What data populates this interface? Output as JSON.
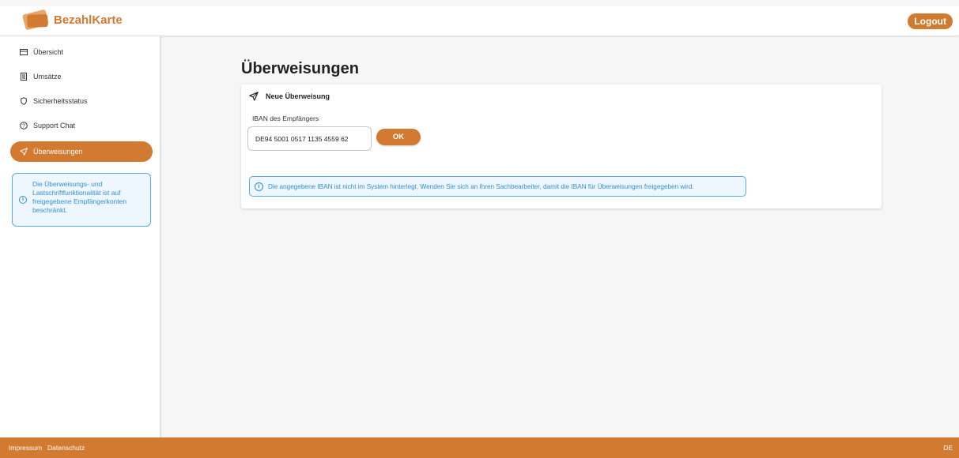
{
  "header": {
    "brand": "BezahlKarte",
    "logout_label": "Logout"
  },
  "sidebar": {
    "items": [
      {
        "label": "Übersicht",
        "icon": "card-icon"
      },
      {
        "label": "Umsätze",
        "icon": "receipt-icon"
      },
      {
        "label": "Sicherheitsstatus",
        "icon": "shield-icon"
      },
      {
        "label": "Support Chat",
        "icon": "help-icon"
      },
      {
        "label": "Überweisungen",
        "icon": "send-icon",
        "active": true
      }
    ],
    "info_text": "Die Überweisungs- und Lastschriftfunktionalität ist auf freigegebene Empfängerkonten beschränkt."
  },
  "main": {
    "title": "Überweisungen",
    "card_title": "Neue Überweisung",
    "iban_label": "IBAN des Empfängers",
    "iban_value": "DE94 5001 0517 1135 4559 62",
    "ok_label": "OK",
    "alert_text": "Die angegebene IBAN ist nicht im System hinterlegt. Wenden Sie sich an Ihren Sachbearbeiter, damit die IBAN für Überweisungen freigegeben wird."
  },
  "footer": {
    "impressum": "Impressum",
    "datenschutz": "Datenschutz",
    "language": "DE"
  },
  "colors": {
    "accent": "#d37a31",
    "info": "#2f8fdb"
  }
}
